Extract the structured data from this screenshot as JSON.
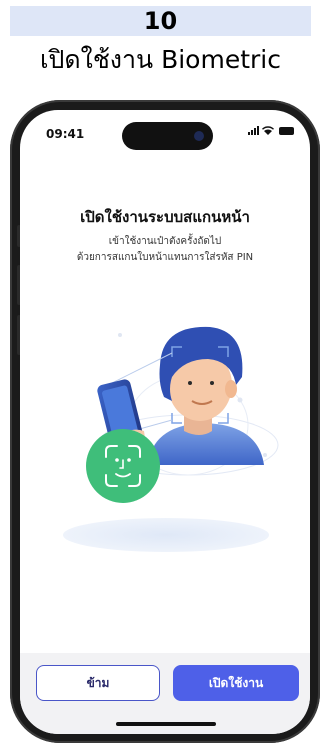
{
  "step": {
    "number": "10",
    "caption": "เปิดใช้งาน Biometric"
  },
  "status_bar": {
    "time": "09:41"
  },
  "content": {
    "title": "เปิดใช้งานระบบสแกนหน้า",
    "subtitle_line1": "เข้าใช้งานเป๋าตังครั้งถัดไป",
    "subtitle_line2": "ด้วยการสแกนใบหน้าแทนการใส่รหัส PIN"
  },
  "buttons": {
    "skip_label": "ข้าม",
    "enable_label": "เปิดใช้งาน"
  },
  "colors": {
    "banner": "#dee6f7",
    "primary": "#4e60e8",
    "face_scan": "#3fbe7a"
  },
  "icons": [
    "signal-icon",
    "wifi-icon",
    "battery-icon",
    "face-scan-icon"
  ]
}
